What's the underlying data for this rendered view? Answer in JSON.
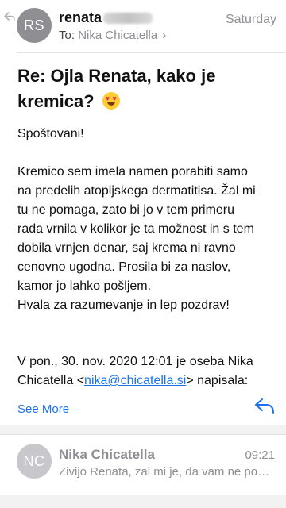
{
  "header": {
    "avatar_initials": "RS",
    "sender": "renata",
    "date": "Saturday",
    "to_label": "To:",
    "to_name": "Nika Chicatella",
    "chevron": "›"
  },
  "subject": "Re: Ojla Renata, kako je kremica?",
  "body": {
    "greeting": "Spoštovani!",
    "lines": [
      "Kremico sem imela namen porabiti samo",
      "na predelih atopijskega dermatitisa. Žal mi",
      "tu ne pomaga, zato bi jo v tem  primeru",
      "rada vrnila v kolikor je ta možnost in s tem",
      "dobila vrnjen denar, saj krema ni ravno",
      "cenovno ugodna. Prosila bi za naslov,",
      "kamor jo lahko pošljem.",
      "Hvala za razumevanje in lep pozdrav!"
    ]
  },
  "quote": {
    "line1": "V pon., 30. nov. 2020 12:01 je oseba Nika",
    "prefix": "Chicatella <",
    "email": "nika@chicatella.si",
    "suffix": "> napisala:"
  },
  "actions": {
    "see_more": "See More",
    "reply_icon": "reply-arrow-icon"
  },
  "thread": {
    "avatar_initials": "NC",
    "sender": "Nika Chicatella",
    "time": "09:21",
    "snippet": "Zivijo Renata, zal mi je, da vam ne pom..."
  },
  "colors": {
    "accent": "#1a73e8",
    "muted": "#8e8e93",
    "avatar": "#8e8e93",
    "avatar_light": "#c7c7cc"
  }
}
